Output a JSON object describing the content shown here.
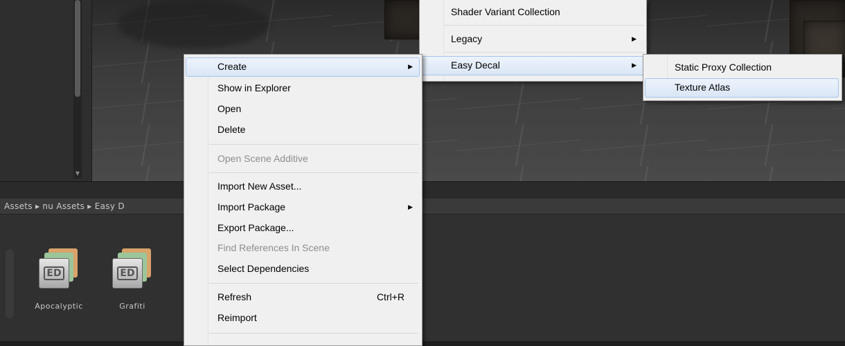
{
  "breadcrumb": "Assets ▸ nu Assets ▸ Easy D",
  "assets": [
    {
      "name": "Apocalyptic",
      "icon_text": "ED"
    },
    {
      "name": "Grafiti",
      "icon_text": "ED"
    }
  ],
  "context_menu": {
    "create": "Create",
    "show_in_explorer": "Show in Explorer",
    "open": "Open",
    "delete": "Delete",
    "open_scene_additive": "Open Scene Additive",
    "import_new_asset": "Import New Asset...",
    "import_package": "Import Package",
    "export_package": "Export Package...",
    "find_references": "Find References In Scene",
    "select_dependencies": "Select Dependencies",
    "refresh": "Refresh",
    "refresh_shortcut": "Ctrl+R",
    "reimport": "Reimport"
  },
  "create_submenu": {
    "shader_variant_collection": "Shader Variant Collection",
    "legacy": "Legacy",
    "easy_decal": "Easy Decal"
  },
  "easy_decal_submenu": {
    "static_proxy_collection": "Static Proxy Collection",
    "texture_atlas": "Texture Atlas"
  },
  "icons": {
    "submenu_arrow": "submenu-arrow-icon",
    "scroll_down": "scroll-down-icon"
  },
  "colors": {
    "menu_bg": "#f0f0f0",
    "highlight_border": "#a5c4ed",
    "disabled_text": "#8d8d8d"
  }
}
